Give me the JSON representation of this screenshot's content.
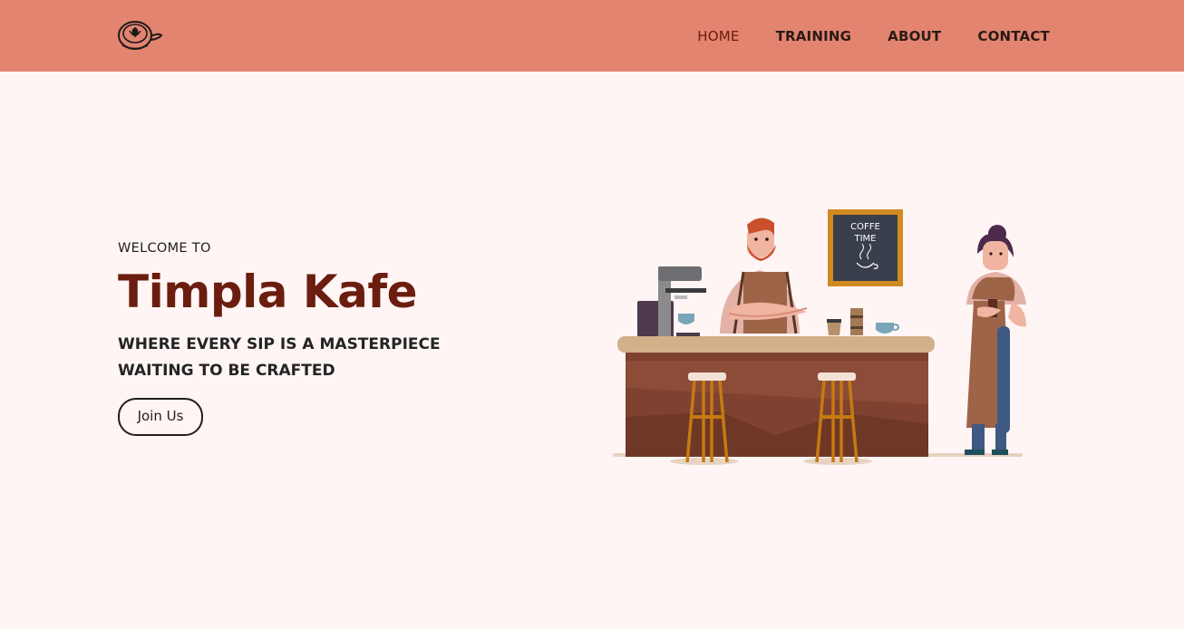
{
  "header": {
    "logo_icon": "coffee-cup-logo-icon",
    "nav": [
      {
        "label": "HOME",
        "active": true
      },
      {
        "label": "TRAINING",
        "active": false
      },
      {
        "label": "ABOUT",
        "active": false
      },
      {
        "label": "CONTACT",
        "active": false
      }
    ]
  },
  "hero": {
    "welcome": "WELCOME TO",
    "title": "Timpla Kafe",
    "tagline_line1": "WHERE EVERY SIP IS A MASTERPIECE",
    "tagline_line2": "WAITING TO BE CRAFTED",
    "cta_label": "Join Us"
  },
  "illustration": {
    "sign_line1": "COFFE",
    "sign_line2": "TIME"
  },
  "colors": {
    "header_bg": "#e2846f",
    "page_bg": "#fff5f4",
    "title_color": "#6b1d0f",
    "active_nav": "#6b1a0e"
  }
}
